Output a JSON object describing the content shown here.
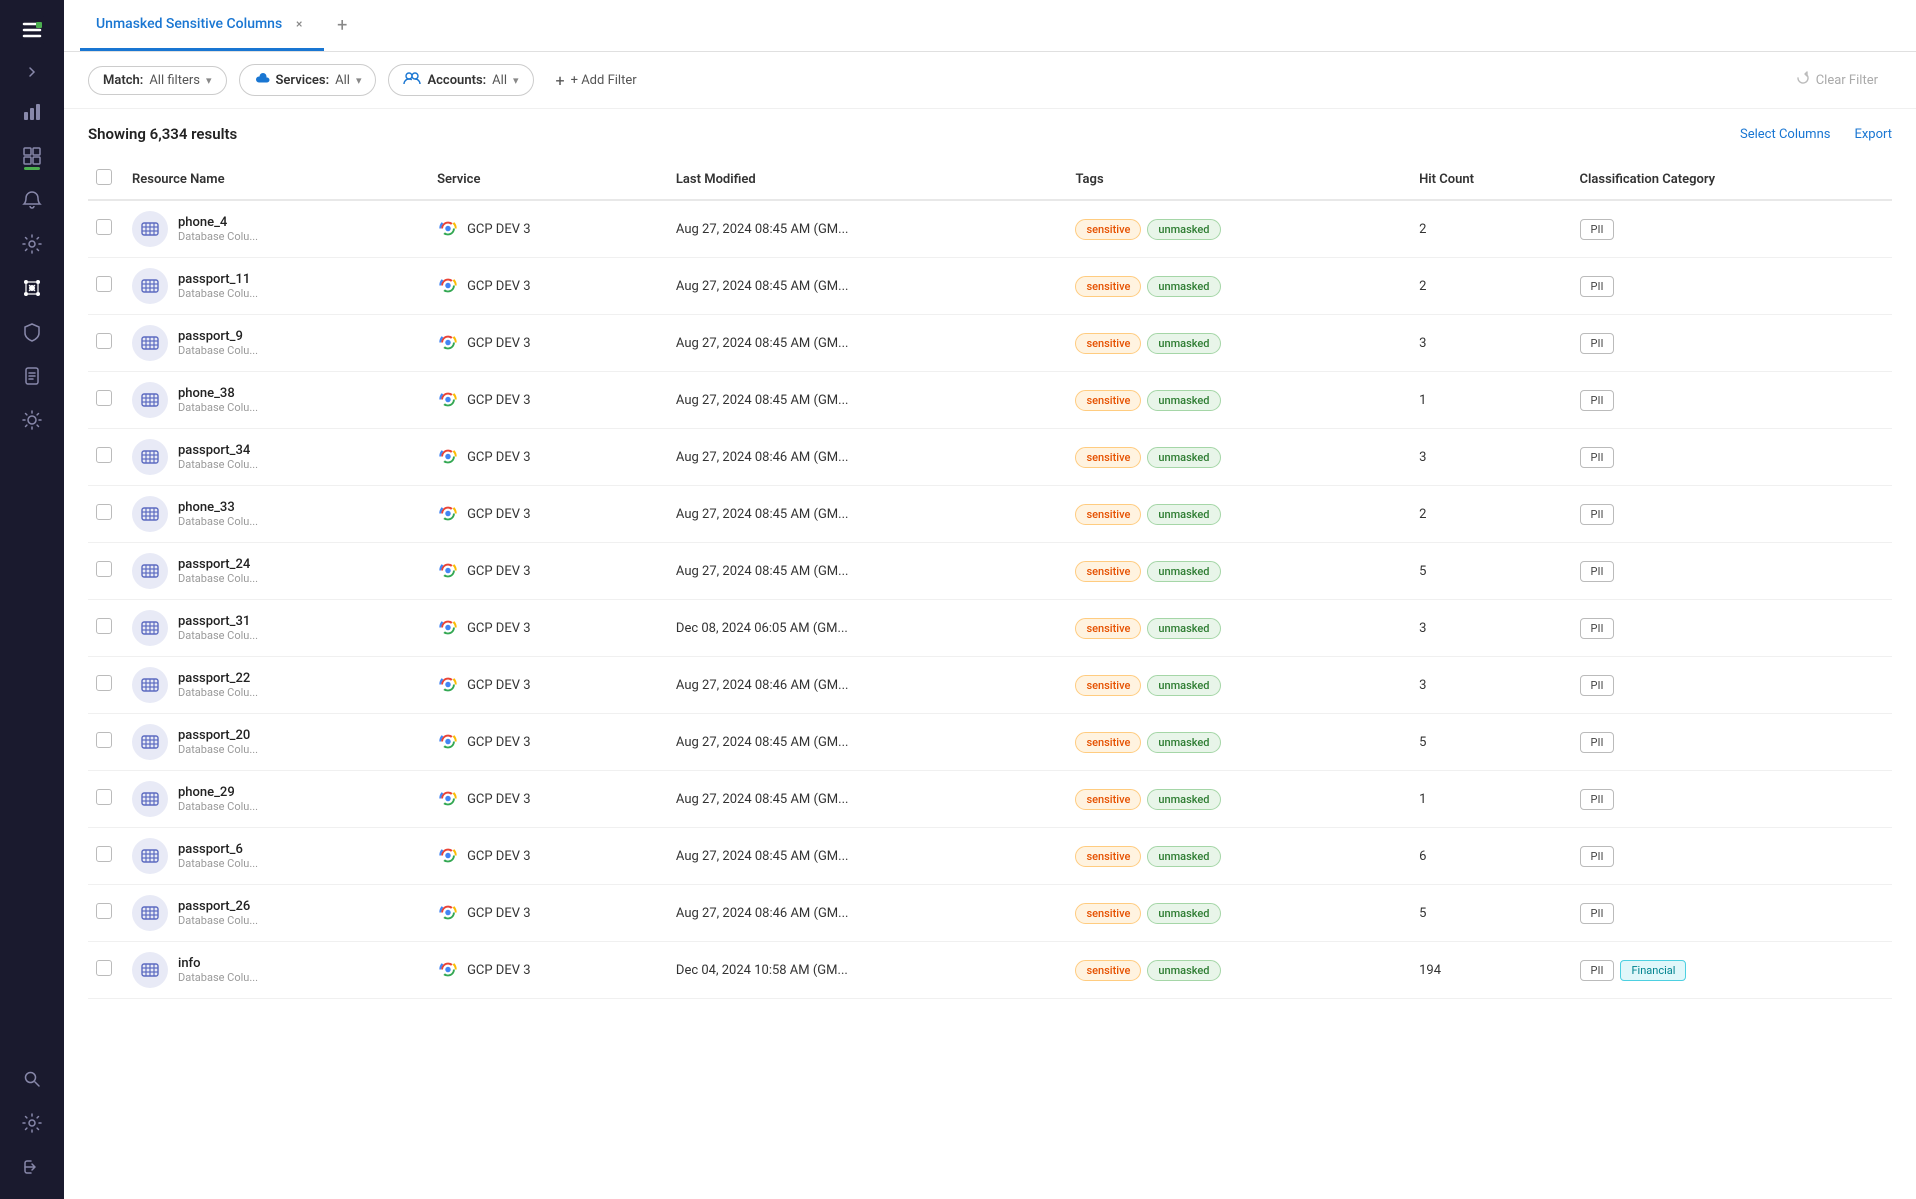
{
  "sidebar": {
    "items": [
      {
        "id": "logo",
        "icon": "☰",
        "active": false
      },
      {
        "id": "expand",
        "icon": "❯",
        "active": false
      },
      {
        "id": "chart",
        "icon": "📊",
        "active": false
      },
      {
        "id": "filter",
        "icon": "⚙",
        "active": false
      },
      {
        "id": "bell",
        "icon": "🔔",
        "active": false
      },
      {
        "id": "lightbulb",
        "icon": "💡",
        "active": false
      },
      {
        "id": "network",
        "icon": "⬡",
        "active": true
      },
      {
        "id": "shield",
        "icon": "🛡",
        "active": false
      },
      {
        "id": "report",
        "icon": "📋",
        "active": false
      },
      {
        "id": "sun",
        "icon": "☀",
        "active": false
      },
      {
        "id": "search",
        "icon": "🔍",
        "active": false
      },
      {
        "id": "settings",
        "icon": "⚙",
        "active": false
      },
      {
        "id": "signout",
        "icon": "→",
        "active": false
      }
    ]
  },
  "tab": {
    "title": "Unmasked Sensitive Columns",
    "close_label": "×",
    "add_label": "+"
  },
  "toolbar": {
    "match_label": "Match:",
    "match_value": "All filters",
    "services_label": "Services:",
    "services_value": "All",
    "accounts_label": "Accounts:",
    "accounts_value": "All",
    "add_filter_label": "+ Add Filter",
    "clear_filter_label": "Clear Filter"
  },
  "results": {
    "count_text": "Showing 6,334 results",
    "select_columns_label": "Select Columns",
    "export_label": "Export"
  },
  "table": {
    "columns": [
      "Resource Name",
      "Service",
      "Last Modified",
      "Tags",
      "Hit Count",
      "Classification Category"
    ],
    "rows": [
      {
        "name": "phone_4",
        "sub": "Database Colu...",
        "service": "GCP DEV 3",
        "modified": "Aug 27, 2024 08:45 AM (GM...",
        "tags": [
          "sensitive",
          "unmasked"
        ],
        "hitCount": 2,
        "classes": [
          "PII"
        ]
      },
      {
        "name": "passport_11",
        "sub": "Database Colu...",
        "service": "GCP DEV 3",
        "modified": "Aug 27, 2024 08:45 AM (GM...",
        "tags": [
          "sensitive",
          "unmasked"
        ],
        "hitCount": 2,
        "classes": [
          "PII"
        ]
      },
      {
        "name": "passport_9",
        "sub": "Database Colu...",
        "service": "GCP DEV 3",
        "modified": "Aug 27, 2024 08:45 AM (GM...",
        "tags": [
          "sensitive",
          "unmasked"
        ],
        "hitCount": 3,
        "classes": [
          "PII"
        ]
      },
      {
        "name": "phone_38",
        "sub": "Database Colu...",
        "service": "GCP DEV 3",
        "modified": "Aug 27, 2024 08:45 AM (GM...",
        "tags": [
          "sensitive",
          "unmasked"
        ],
        "hitCount": 1,
        "classes": [
          "PII"
        ]
      },
      {
        "name": "passport_34",
        "sub": "Database Colu...",
        "service": "GCP DEV 3",
        "modified": "Aug 27, 2024 08:46 AM (GM...",
        "tags": [
          "sensitive",
          "unmasked"
        ],
        "hitCount": 3,
        "classes": [
          "PII"
        ]
      },
      {
        "name": "phone_33",
        "sub": "Database Colu...",
        "service": "GCP DEV 3",
        "modified": "Aug 27, 2024 08:45 AM (GM...",
        "tags": [
          "sensitive",
          "unmasked"
        ],
        "hitCount": 2,
        "classes": [
          "PII"
        ]
      },
      {
        "name": "passport_24",
        "sub": "Database Colu...",
        "service": "GCP DEV 3",
        "modified": "Aug 27, 2024 08:45 AM (GM...",
        "tags": [
          "sensitive",
          "unmasked"
        ],
        "hitCount": 5,
        "classes": [
          "PII"
        ]
      },
      {
        "name": "passport_31",
        "sub": "Database Colu...",
        "service": "GCP DEV 3",
        "modified": "Dec 08, 2024 06:05 AM (GM...",
        "tags": [
          "sensitive",
          "unmasked"
        ],
        "hitCount": 3,
        "classes": [
          "PII"
        ]
      },
      {
        "name": "passport_22",
        "sub": "Database Colu...",
        "service": "GCP DEV 3",
        "modified": "Aug 27, 2024 08:46 AM (GM...",
        "tags": [
          "sensitive",
          "unmasked"
        ],
        "hitCount": 3,
        "classes": [
          "PII"
        ]
      },
      {
        "name": "passport_20",
        "sub": "Database Colu...",
        "service": "GCP DEV 3",
        "modified": "Aug 27, 2024 08:45 AM (GM...",
        "tags": [
          "sensitive",
          "unmasked"
        ],
        "hitCount": 5,
        "classes": [
          "PII"
        ]
      },
      {
        "name": "phone_29",
        "sub": "Database Colu...",
        "service": "GCP DEV 3",
        "modified": "Aug 27, 2024 08:45 AM (GM...",
        "tags": [
          "sensitive",
          "unmasked"
        ],
        "hitCount": 1,
        "classes": [
          "PII"
        ]
      },
      {
        "name": "passport_6",
        "sub": "Database Colu...",
        "service": "GCP DEV 3",
        "modified": "Aug 27, 2024 08:45 AM (GM...",
        "tags": [
          "sensitive",
          "unmasked"
        ],
        "hitCount": 6,
        "classes": [
          "PII"
        ]
      },
      {
        "name": "passport_26",
        "sub": "Database Colu...",
        "service": "GCP DEV 3",
        "modified": "Aug 27, 2024 08:46 AM (GM...",
        "tags": [
          "sensitive",
          "unmasked"
        ],
        "hitCount": 5,
        "classes": [
          "PII"
        ]
      },
      {
        "name": "info",
        "sub": "Database Colu...",
        "service": "GCP DEV 3",
        "modified": "Dec 04, 2024 10:58 AM (GM...",
        "tags": [
          "sensitive",
          "unmasked"
        ],
        "hitCount": 194,
        "classes": [
          "PII",
          "Financial"
        ]
      }
    ]
  }
}
